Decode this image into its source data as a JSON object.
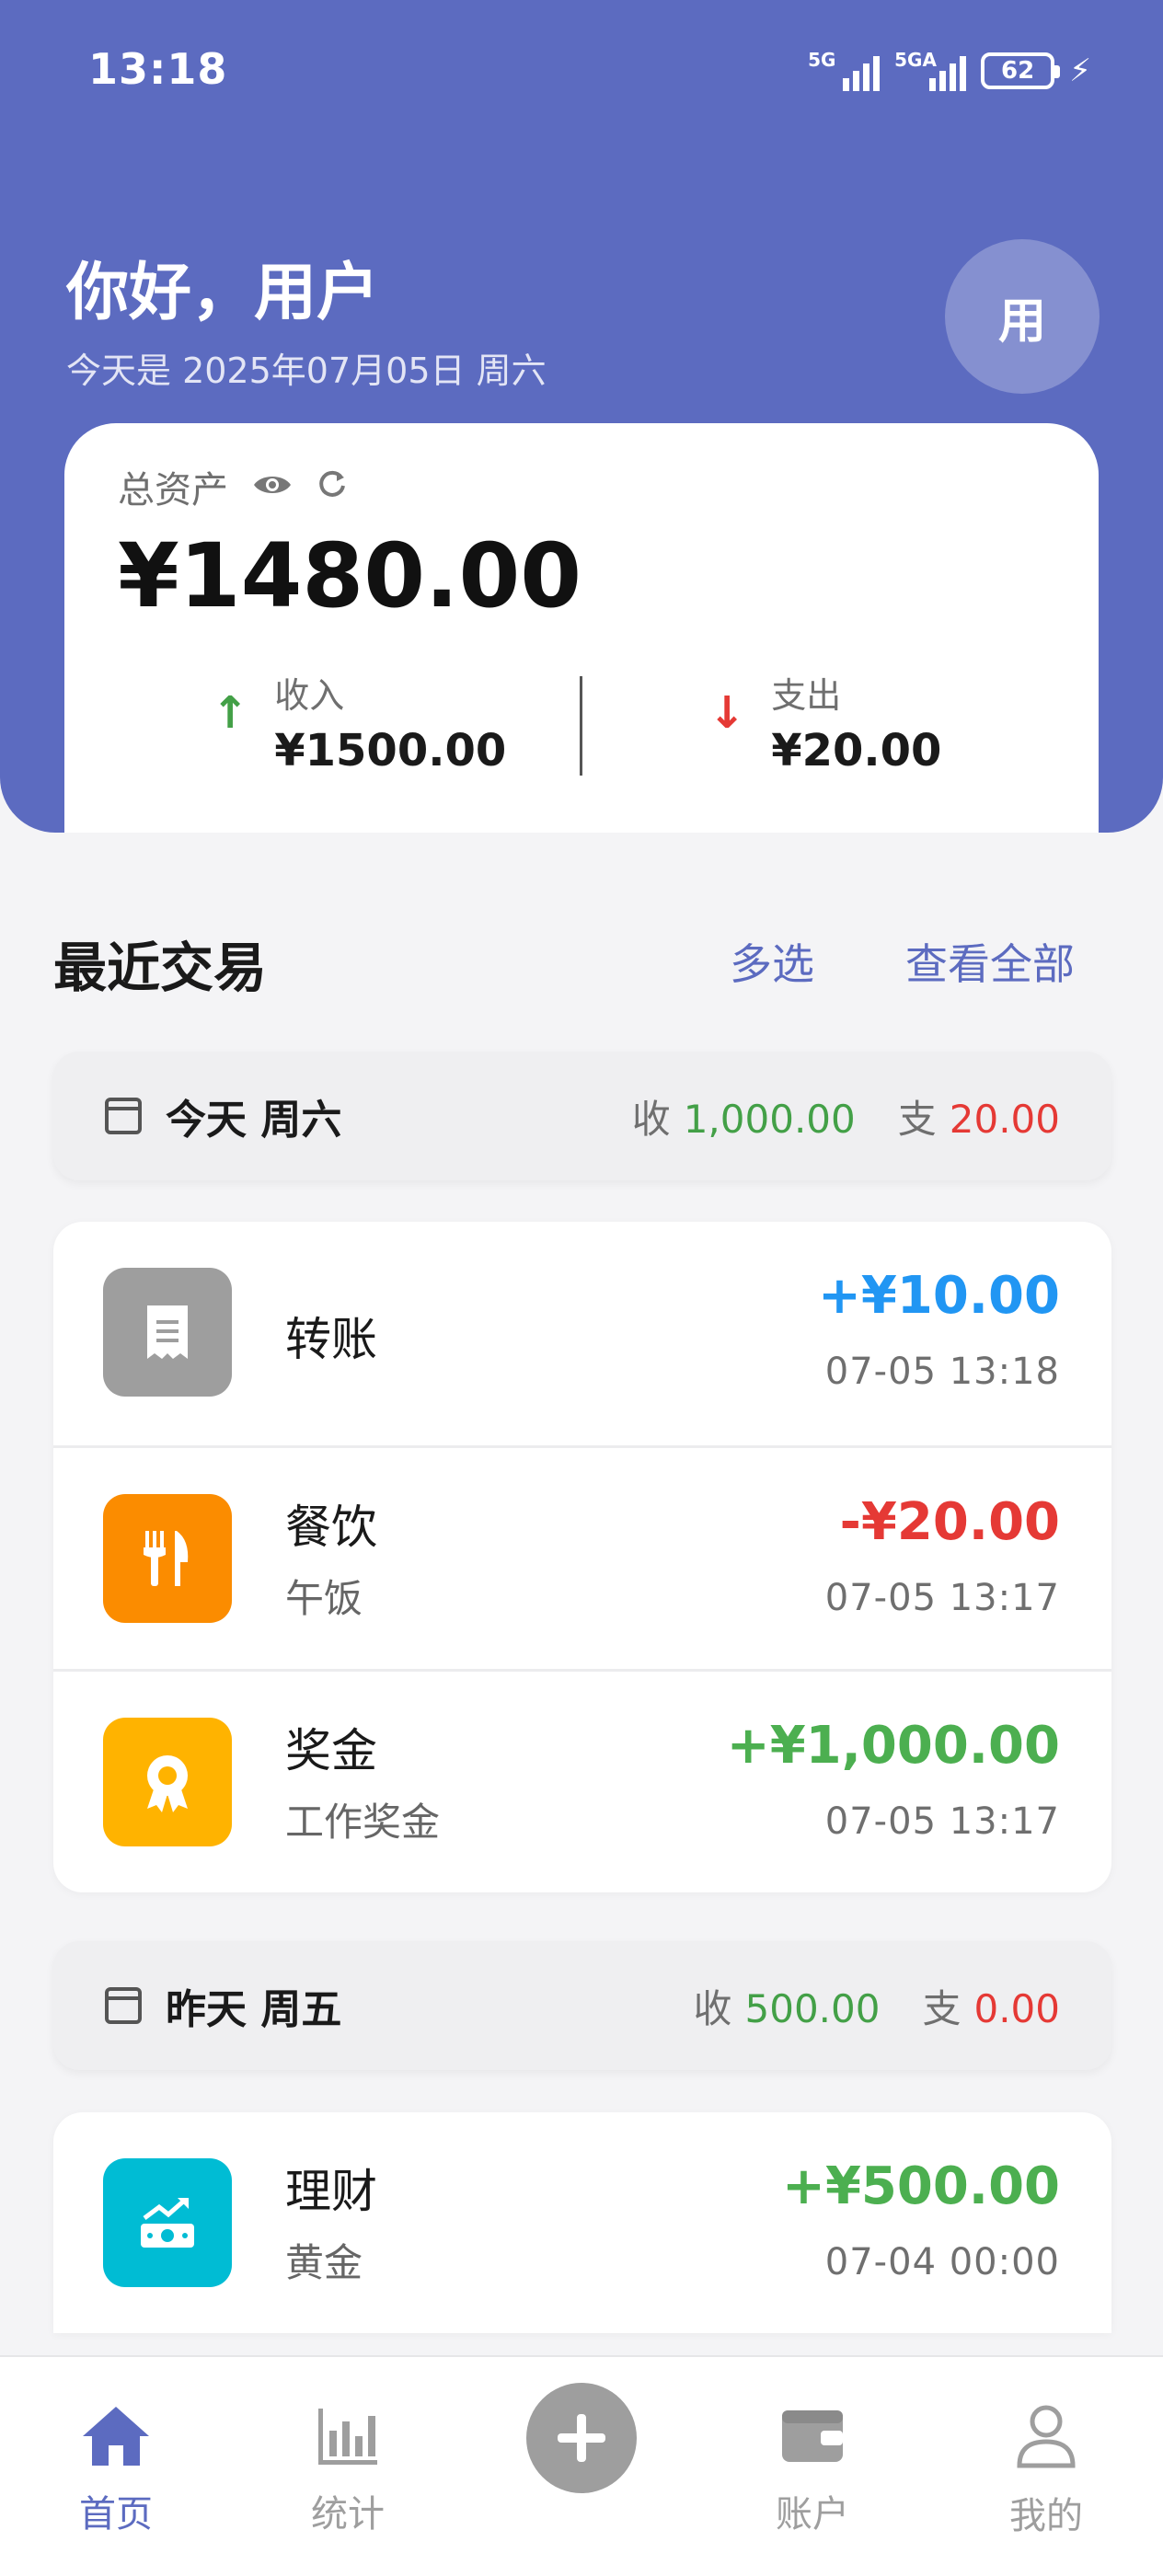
{
  "status_bar": {
    "time": "13:18",
    "network_1": "5G",
    "network_2": "5GA",
    "battery": "62"
  },
  "header": {
    "greeting": "你好，用户",
    "date_line": "今天是 2025年07月05日 周六",
    "avatar_text": "用"
  },
  "assets": {
    "label": "总资产",
    "total": "¥1480.00",
    "income_label": "收入",
    "income_value": "¥1500.00",
    "expense_label": "支出",
    "expense_value": "¥20.00"
  },
  "recent": {
    "title": "最近交易",
    "multi_select": "多选",
    "view_all": "查看全部"
  },
  "groups": [
    {
      "title": "今天 周六",
      "income_prefix": "收",
      "income": "1,000.00",
      "expense_prefix": "支",
      "expense": "20.00",
      "transactions": [
        {
          "category": "转账",
          "note": "",
          "amount": "+¥10.00",
          "time": "07-05 13:18",
          "icon": "receipt-icon",
          "color": "#9e9e9e",
          "amount_color": "#2196f3"
        },
        {
          "category": "餐饮",
          "note": "午饭",
          "amount": "-¥20.00",
          "time": "07-05 13:17",
          "icon": "dining-icon",
          "color": "#fb8c00",
          "amount_color": "#e53935"
        },
        {
          "category": "奖金",
          "note": "工作奖金",
          "amount": "+¥1,000.00",
          "time": "07-05 13:17",
          "icon": "award-icon",
          "color": "#ffb300",
          "amount_color": "#4caf50"
        }
      ]
    },
    {
      "title": "昨天 周五",
      "income_prefix": "收",
      "income": "500.00",
      "expense_prefix": "支",
      "expense": "0.00",
      "transactions": [
        {
          "category": "理财",
          "note": "黄金",
          "amount": "+¥500.00",
          "time": "07-04 00:00",
          "icon": "investment-icon",
          "color": "#00bcd4",
          "amount_color": "#4caf50"
        }
      ]
    }
  ],
  "nav": {
    "home": "首页",
    "stats": "统计",
    "accounts": "账户",
    "mine": "我的"
  },
  "colors": {
    "primary": "#5c6bc0",
    "income": "#43a047",
    "expense": "#e53935"
  }
}
